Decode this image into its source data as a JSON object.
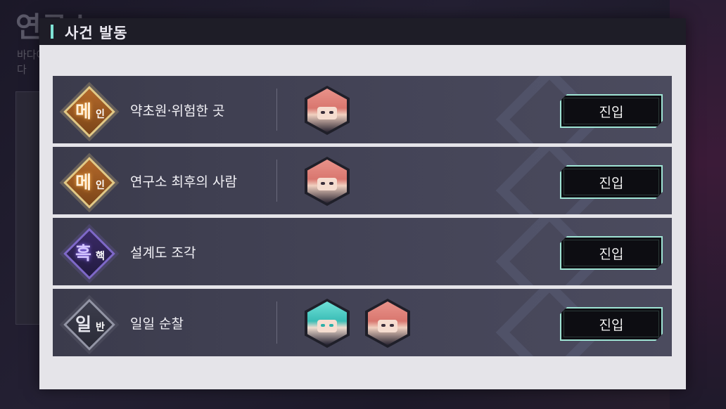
{
  "background": {
    "title": "연구소",
    "description": "바다에 건설된 기괴한 시설 · 소문에 따르면 비밀연구 기관이라 한다"
  },
  "modal": {
    "title": "사건 발동"
  },
  "events": [
    {
      "badge_big": "메",
      "badge_small": "인",
      "badge_type": "main",
      "title": "약초원·위험한 곳",
      "avatars": [
        "pink-hair-character"
      ],
      "button_label": "진입"
    },
    {
      "badge_big": "메",
      "badge_small": "인",
      "badge_type": "main",
      "title": "연구소 최후의 사람",
      "avatars": [
        "pink-hair-character"
      ],
      "button_label": "진입"
    },
    {
      "badge_big": "흑",
      "badge_small": "핵",
      "badge_type": "black",
      "title": "설계도 조각",
      "avatars": [],
      "button_label": "진입"
    },
    {
      "badge_big": "일",
      "badge_small": "반",
      "badge_type": "normal",
      "title": "일일 순찰",
      "avatars": [
        "teal-hair-character",
        "pink-hair-character"
      ],
      "button_label": "진입"
    }
  ],
  "colors": {
    "accent": "#7fe3d6",
    "main_badge": "#e3c985",
    "black_badge": "#7e68c8",
    "normal_badge": "#9294a4"
  }
}
